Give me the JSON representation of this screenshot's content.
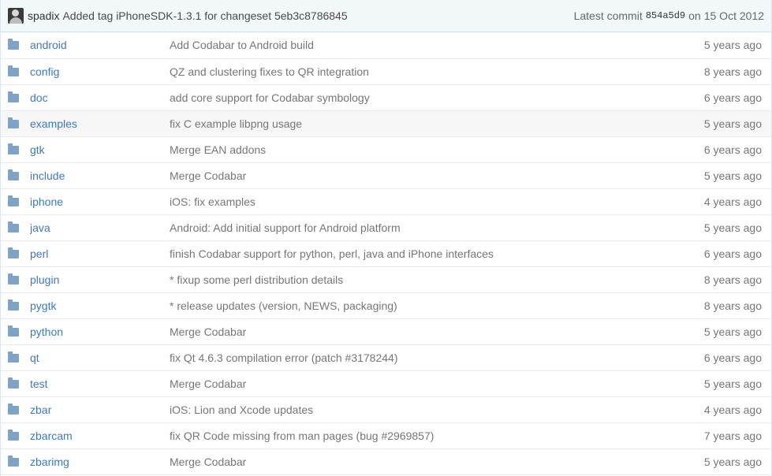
{
  "commit_tease": {
    "author": "spadix",
    "message": "Added tag iPhoneSDK-1.3.1 for changeset 5eb3c8786845",
    "latest_label": "Latest commit",
    "sha": "854a5d9",
    "on_label": "on",
    "date": "15 Oct 2012"
  },
  "files": [
    {
      "name": "android",
      "message": "Add Codabar to Android build",
      "age": "5 years ago"
    },
    {
      "name": "config",
      "message": "QZ and clustering fixes to QR integration",
      "age": "8 years ago"
    },
    {
      "name": "doc",
      "message": "add core support for Codabar symbology",
      "age": "6 years ago"
    },
    {
      "name": "examples",
      "message": "fix C example libpng usage",
      "age": "5 years ago"
    },
    {
      "name": "gtk",
      "message": "Merge EAN addons",
      "age": "6 years ago"
    },
    {
      "name": "include",
      "message": "Merge Codabar",
      "age": "5 years ago"
    },
    {
      "name": "iphone",
      "message": "iOS: fix examples",
      "age": "4 years ago"
    },
    {
      "name": "java",
      "message": "Android: Add initial support for Android platform",
      "age": "5 years ago"
    },
    {
      "name": "perl",
      "message": "finish Codabar support for python, perl, java and iPhone interfaces",
      "age": "6 years ago"
    },
    {
      "name": "plugin",
      "message": "* fixup some perl distribution details",
      "age": "8 years ago"
    },
    {
      "name": "pygtk",
      "message": "* release updates (version, NEWS, packaging)",
      "age": "8 years ago"
    },
    {
      "name": "python",
      "message": "Merge Codabar",
      "age": "5 years ago"
    },
    {
      "name": "qt",
      "message": "fix Qt 4.6.3 compilation error (patch #3178244)",
      "age": "6 years ago"
    },
    {
      "name": "test",
      "message": "Merge Codabar",
      "age": "5 years ago"
    },
    {
      "name": "zbar",
      "message": "iOS: Lion and Xcode updates",
      "age": "4 years ago"
    },
    {
      "name": "zbarcam",
      "message": "fix QR Code missing from man pages (bug #2969857)",
      "age": "7 years ago"
    },
    {
      "name": "zbarimg",
      "message": "Merge Codabar",
      "age": "5 years ago"
    }
  ]
}
